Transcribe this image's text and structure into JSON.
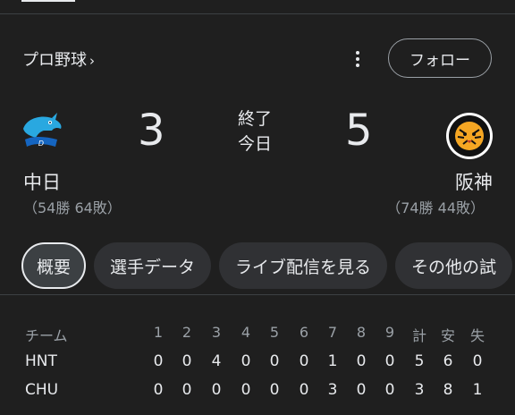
{
  "header": {
    "league": "プロ野球",
    "chevron": "›",
    "follow_label": "フォロー"
  },
  "game": {
    "status_line1": "終了",
    "status_line2": "今日",
    "away": {
      "name": "中日",
      "record": "（54勝 64敗）",
      "score": "3",
      "logo": "dragons-logo",
      "color": "#1e88e5"
    },
    "home": {
      "name": "阪神",
      "record": "（74勝 44敗）",
      "score": "5",
      "logo": "tigers-logo",
      "color": "#f5b400"
    }
  },
  "chips": [
    "概要",
    "選手データ",
    "ライブ配信を見る",
    "その他の試"
  ],
  "boxscore": {
    "columns": [
      "チーム",
      "1",
      "2",
      "3",
      "4",
      "5",
      "6",
      "7",
      "8",
      "9",
      "計",
      "安",
      "失"
    ],
    "rows": [
      {
        "team": "HNT",
        "cells": [
          "0",
          "0",
          "4",
          "0",
          "0",
          "0",
          "1",
          "0",
          "0",
          "5",
          "6",
          "0"
        ]
      },
      {
        "team": "CHU",
        "cells": [
          "0",
          "0",
          "0",
          "0",
          "0",
          "0",
          "3",
          "0",
          "0",
          "3",
          "8",
          "1"
        ]
      }
    ]
  }
}
